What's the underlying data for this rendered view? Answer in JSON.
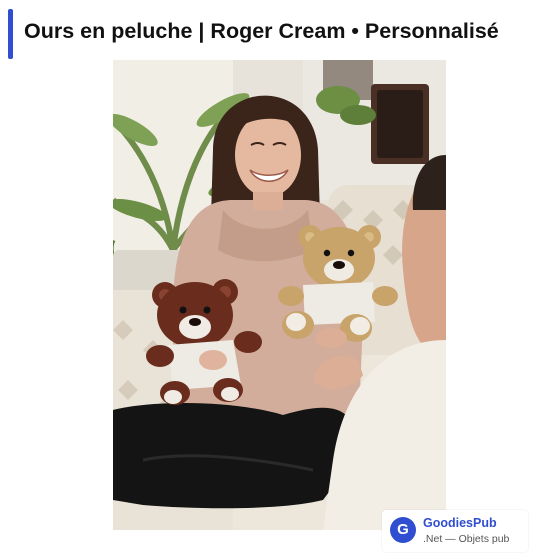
{
  "page": {
    "title": "Ours en peluche | Roger Cream • Personnalisé",
    "accent_color": "#2f4fd0"
  },
  "photo": {
    "subject_icon": "teddy-bear-icon"
  },
  "brand": {
    "logo_letter": "G",
    "name": "GoodiesPub",
    "tagline": ".Net — Objets pub",
    "color": "#2f4fd0"
  }
}
